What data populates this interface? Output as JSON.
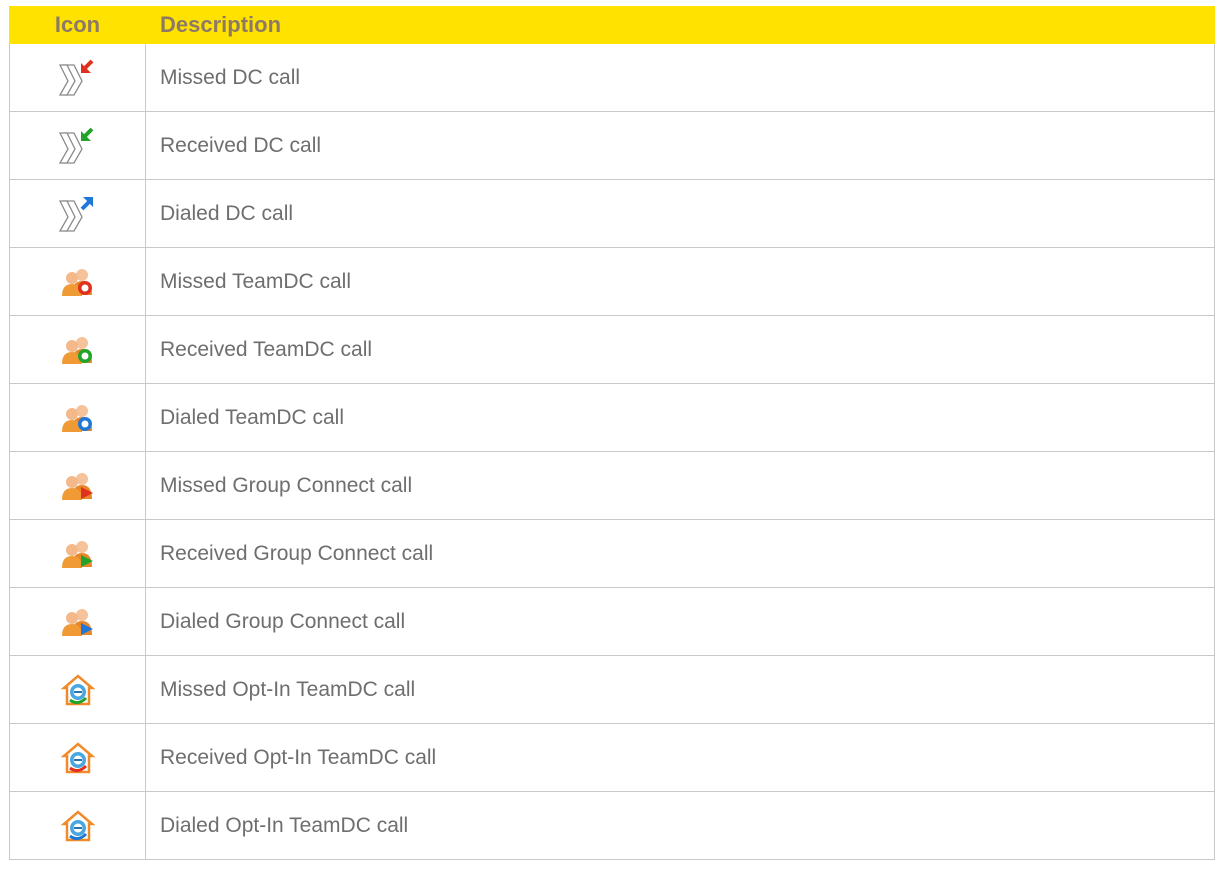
{
  "headers": {
    "icon": "Icon",
    "description": "Description"
  },
  "rows": [
    {
      "icon": "dc-missed-icon",
      "description": "Missed DC call"
    },
    {
      "icon": "dc-received-icon",
      "description": "Received DC call"
    },
    {
      "icon": "dc-dialed-icon",
      "description": "Dialed DC call"
    },
    {
      "icon": "teamdc-missed-icon",
      "description": "Missed TeamDC call"
    },
    {
      "icon": "teamdc-received-icon",
      "description": "Received TeamDC call"
    },
    {
      "icon": "teamdc-dialed-icon",
      "description": "Dialed TeamDC call"
    },
    {
      "icon": "group-connect-missed-icon",
      "description": "Missed Group Connect call"
    },
    {
      "icon": "group-connect-received-icon",
      "description": "Received Group Connect call"
    },
    {
      "icon": "group-connect-dialed-icon",
      "description": "Dialed Group Connect call"
    },
    {
      "icon": "optin-teamdc-missed-icon",
      "description": "Missed Opt-In TeamDC call"
    },
    {
      "icon": "optin-teamdc-received-icon",
      "description": "Received Opt-In TeamDC call"
    },
    {
      "icon": "optin-teamdc-dialed-icon",
      "description": "Dialed Opt-In TeamDC call"
    }
  ],
  "colors": {
    "header_bg": "#ffe200",
    "header_text": "#8c7a66",
    "body_text": "#6e6e6e",
    "border": "#c9c9c9",
    "missed": "#e0301e",
    "received": "#22a32a",
    "dialed": "#1f78d8"
  }
}
